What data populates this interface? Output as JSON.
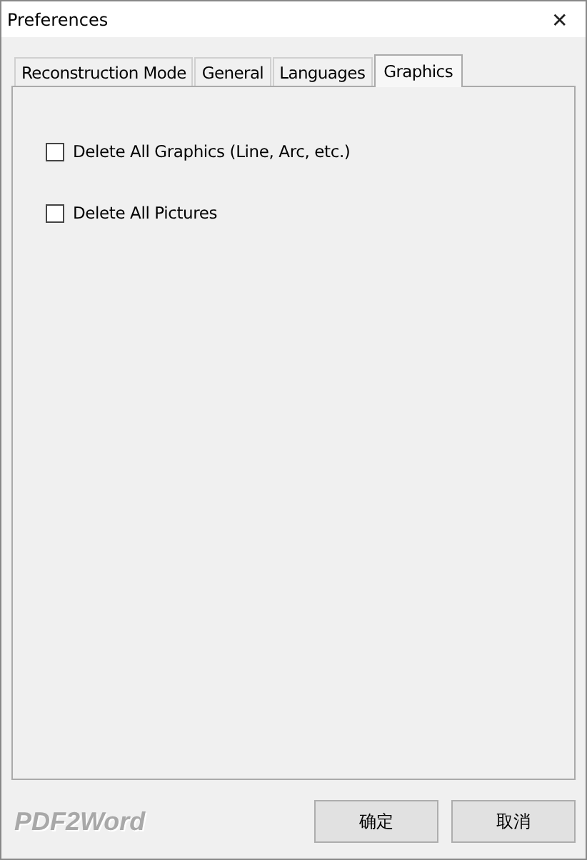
{
  "window": {
    "title": "Preferences",
    "close": "✕"
  },
  "tabs": [
    {
      "label": "Reconstruction Mode",
      "selected": false
    },
    {
      "label": "General",
      "selected": false
    },
    {
      "label": "Languages",
      "selected": false
    },
    {
      "label": "Graphics",
      "selected": true
    }
  ],
  "options": [
    {
      "label": "Delete All Graphics (Line, Arc, etc.)",
      "checked": false
    },
    {
      "label": "Delete All Pictures",
      "checked": false
    }
  ],
  "brand": "PDF2Word",
  "buttons": [
    "确定",
    "取消"
  ]
}
